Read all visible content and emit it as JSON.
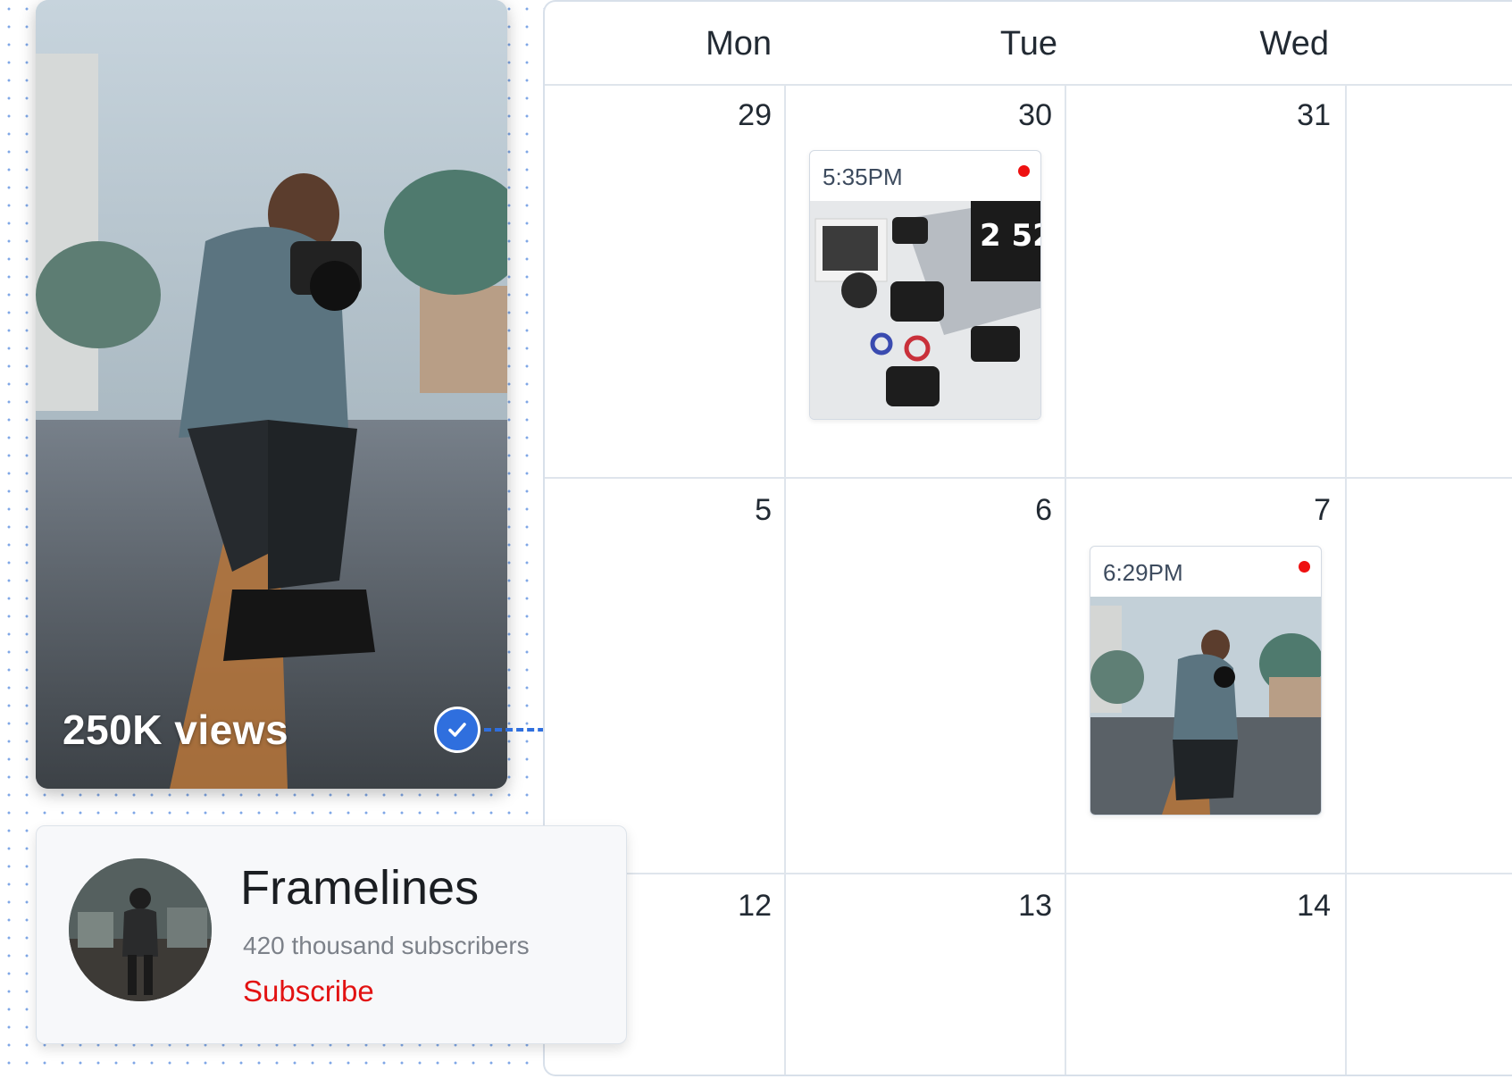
{
  "video": {
    "views_label": "250K views",
    "check_icon": "check-icon",
    "accent_color": "#2f6fde"
  },
  "calendar": {
    "days": [
      "Mon",
      "Tue",
      "Wed"
    ],
    "weeks": [
      [
        "29",
        "30",
        "31"
      ],
      [
        "5",
        "6",
        "7"
      ],
      [
        "12",
        "13",
        "14"
      ]
    ],
    "events": [
      {
        "day": "30",
        "time": "5:35PM",
        "status_color": "#ee1111",
        "thumbnail": "camera-gear-flatlay-image"
      },
      {
        "day": "7",
        "time": "6:29PM",
        "status_color": "#ee1111",
        "thumbnail": "photographer-on-road-image"
      }
    ]
  },
  "channel": {
    "name": "Framelines",
    "subscribers": "420 thousand subscribers",
    "subscribe_label": "Subscribe",
    "subscribe_color": "#e21212"
  }
}
